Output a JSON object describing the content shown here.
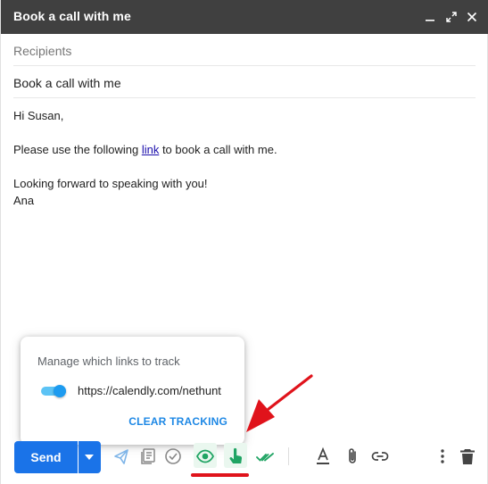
{
  "window": {
    "title": "Book a call with me"
  },
  "fields": {
    "recipients_placeholder": "Recipients",
    "subject": "Book a call with me"
  },
  "body": {
    "greeting": "Hi Susan,",
    "line_before_link": "Please use the following ",
    "link_text": "link",
    "line_after_link": " to book a call with me.",
    "closing": "Looking forward to speaking with you!",
    "signature": "Ana"
  },
  "popup": {
    "heading": "Manage which links to track",
    "link_url": "https://calendly.com/nethunt",
    "toggle_on": true,
    "clear_label": "CLEAR TRACKING"
  },
  "toolbar": {
    "send_label": "Send",
    "icons": [
      "send-options-icon",
      "templates-icon",
      "check-circle-icon",
      "eye-tracking-icon",
      "link-click-tracking-icon",
      "double-check-icon",
      "text-format-icon",
      "attach-icon",
      "insert-link-icon",
      "more-options-icon",
      "delete-icon"
    ]
  },
  "colors": {
    "titlebar": "#404040",
    "send_button": "#1a73e8",
    "tracking_green": "#1fa463",
    "annotation_red": "#e0131b",
    "clear_link": "#1e88e5"
  }
}
